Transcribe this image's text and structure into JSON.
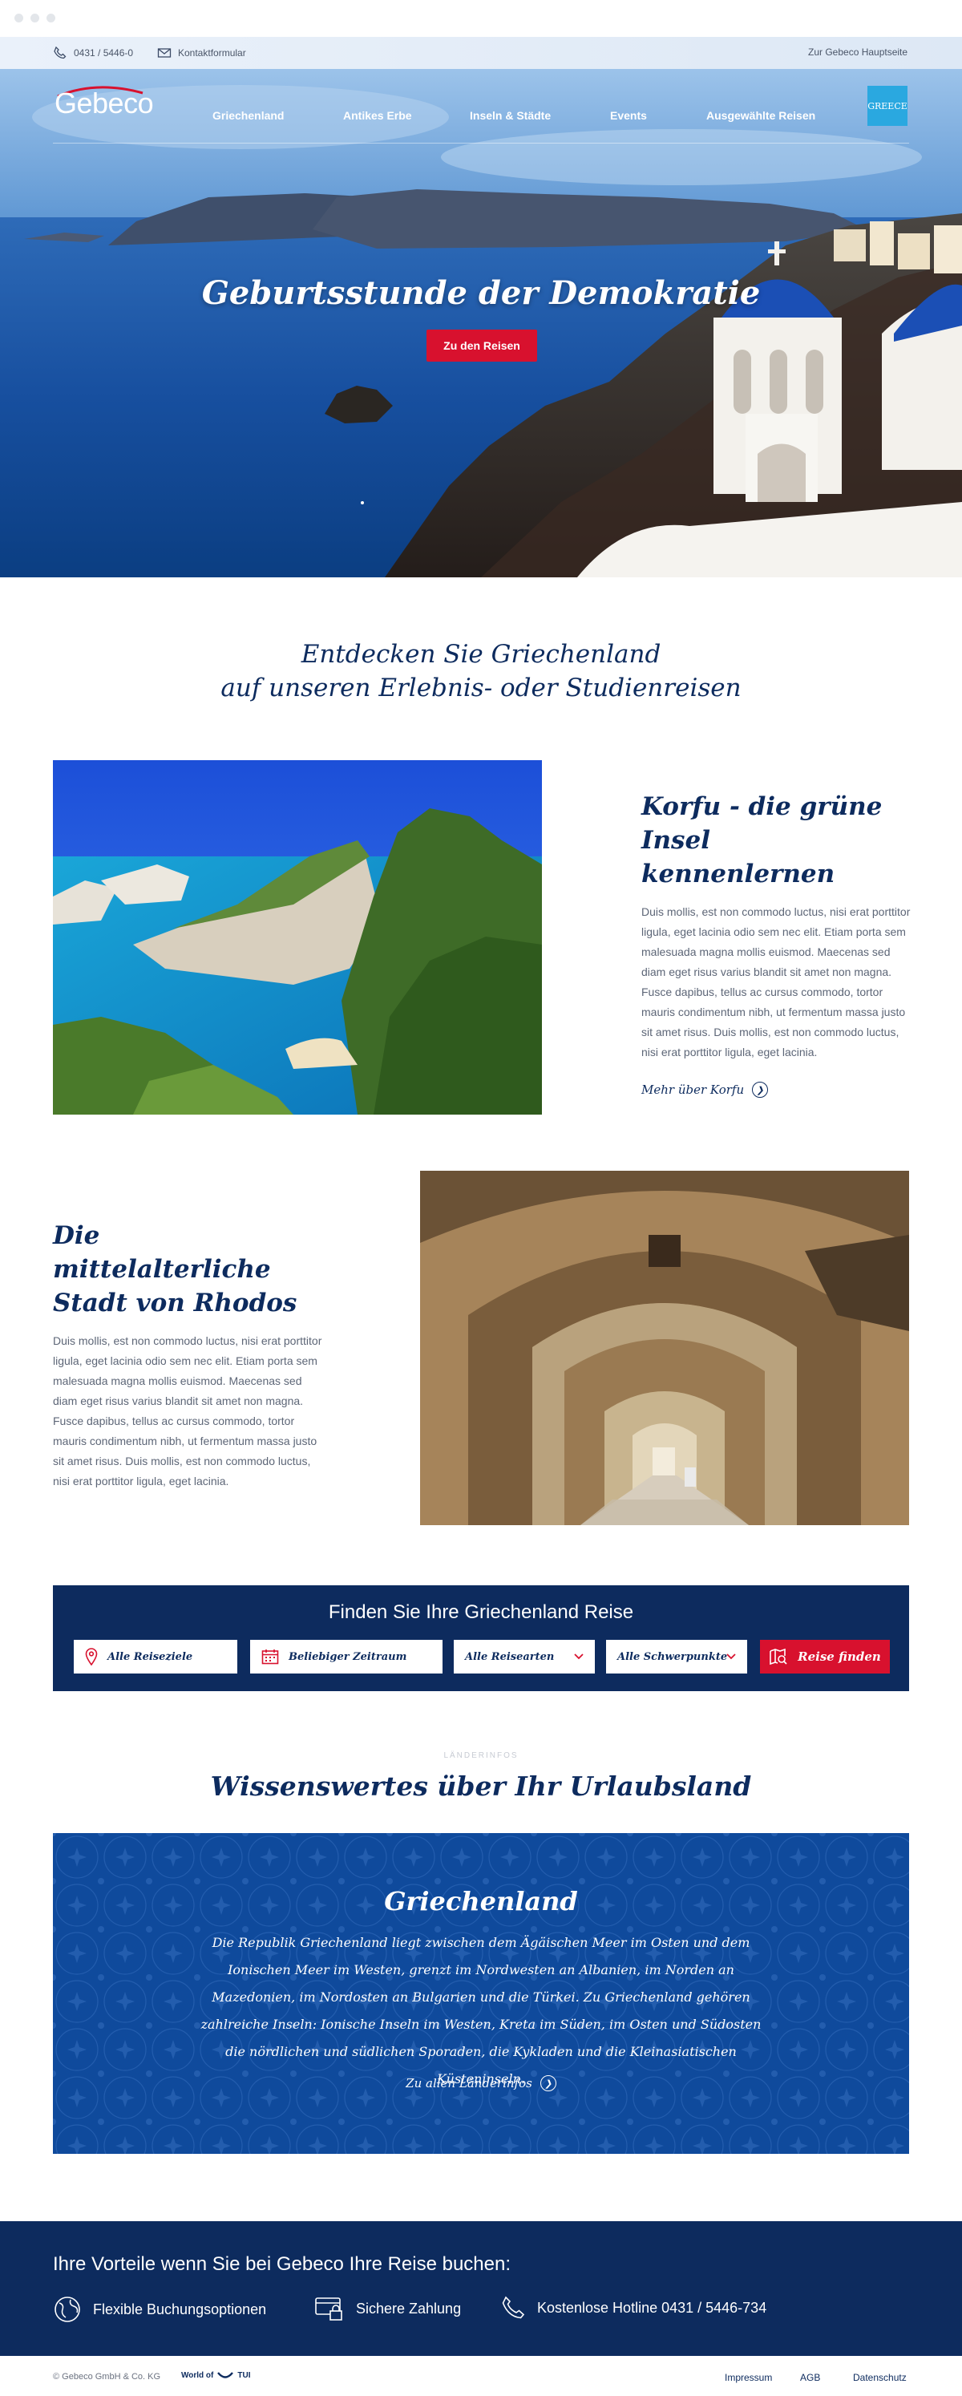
{
  "topbar": {
    "phone": "0431 / 5446-0",
    "contact": "Kontaktformular",
    "main_site": "Zur Gebeco Hauptseite"
  },
  "header": {
    "logo": "Gebeco",
    "nav": [
      "Griechenland",
      "Antikes Erbe",
      "Inseln & Städte",
      "Events",
      "Ausgewählte Reisen"
    ],
    "badge": "GREECE"
  },
  "hero": {
    "title": "Geburtsstunde der Demokratie",
    "cta": "Zu den Reisen"
  },
  "intro": {
    "line1": "Entdecken Sie Griechenland",
    "line2": "auf unseren Erlebnis- oder Studienreisen"
  },
  "korfu": {
    "title_line1": "Korfu - die grüne Insel",
    "title_line2": "kennenlernen",
    "text": "Duis mollis, est non commodo luctus, nisi erat porttitor ligula, eget lacinia odio sem nec elit. Etiam porta sem malesuada magna mollis euismod. Maecenas sed diam eget risus varius blandit sit amet non magna. Fusce dapibus, tellus ac cursus commodo, tortor mauris condimentum nibh, ut fermentum massa justo sit amet risus. Duis mollis, est non commodo luctus, nisi erat porttitor ligula, eget lacinia.",
    "link": "Mehr über Korfu"
  },
  "rhodos": {
    "title_line1": "Die mittelalterliche",
    "title_line2": "Stadt von Rhodos",
    "text": "Duis mollis, est non commodo luctus, nisi erat porttitor ligula, eget lacinia odio sem nec elit. Etiam porta sem malesuada magna mollis euismod. Maecenas sed diam eget risus varius blandit sit amet non magna. Fusce dapibus, tellus ac cursus commodo, tortor mauris condimentum nibh, ut fermentum massa justo sit amet risus. Duis mollis, est non commodo luctus, nisi erat porttitor ligula, eget lacinia."
  },
  "search": {
    "title": "Finden Sie Ihre Griechenland Reise",
    "destination": "Alle Reiseziele",
    "period": "Beliebiger Zeitraum",
    "travel_type": "Alle Reisearten",
    "focus": "Alle Schwerpunkte",
    "button": "Reise finden"
  },
  "info": {
    "kicker": "LÄNDERINFOS",
    "title": "Wissenswertes über Ihr Urlaubsland",
    "box_title": "Griechenland",
    "box_text": "Die Republik Griechenland liegt zwischen dem Ägäischen Meer im Osten und dem Ionischen Meer im Westen, grenzt im Nordwesten an Albanien, im Norden an Mazedonien, im Nordosten an Bulgarien und die Türkei. Zu Griechenland gehören zahlreiche Inseln: Ionische Inseln im Westen, Kreta im Süden, im Osten und Südosten die nördlichen und südlichen Sporaden, die Kykladen und die Kleinasiatischen Küsteninseln.",
    "box_link": "Zu allen Länderinfos"
  },
  "footer": {
    "title": "Ihre Vorteile wenn Sie bei Gebeco Ihre Reise buchen:",
    "features": [
      "Flexible Buchungsoptionen",
      "Sichere Zahlung",
      "Kostenlose Hotline 0431 / 5446-734"
    ],
    "copyright": "© Gebeco GmbH & Co. KG",
    "partner": "World of",
    "partner_brand": "TUI",
    "links": [
      "Impressum",
      "AGB",
      "Datenschutz"
    ]
  },
  "colors": {
    "navy": "#0d2b5e",
    "red": "#d8112e",
    "info_blue": "#0f4a9c",
    "badge_blue": "#2aa8e0"
  }
}
